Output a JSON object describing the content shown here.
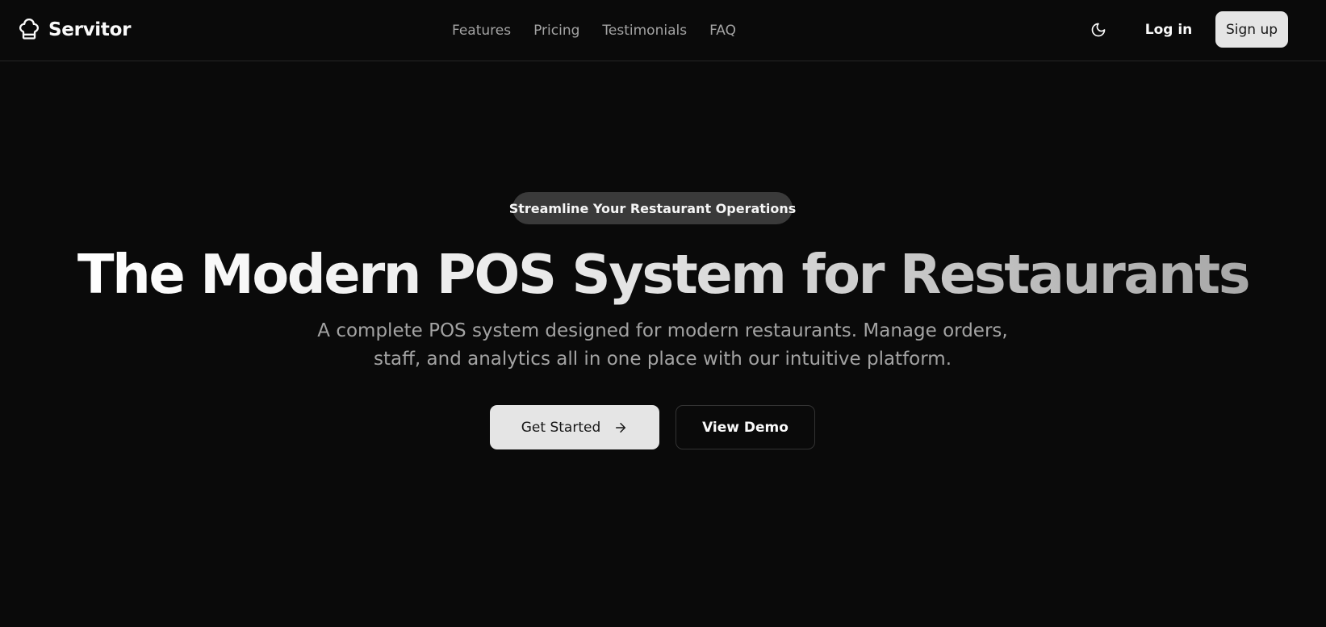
{
  "brand": {
    "name": "Servitor",
    "icon": "chef-hat-icon"
  },
  "nav": {
    "items": [
      {
        "label": "Features"
      },
      {
        "label": "Pricing"
      },
      {
        "label": "Testimonials"
      },
      {
        "label": "FAQ"
      }
    ]
  },
  "header": {
    "theme_icon": "moon-icon",
    "login_label": "Log in",
    "signup_label": "Sign up"
  },
  "hero": {
    "badge": "Streamline Your Restaurant Operations",
    "title": "The Modern POS System for Restaurants",
    "subtitle_line1": "A complete POS system designed for modern restaurants. Manage orders,",
    "subtitle_line2": "staff, and analytics all in one place with our intuitive platform.",
    "primary_cta": "Get Started",
    "primary_cta_icon": "arrow-right-icon",
    "secondary_cta": "View Demo"
  },
  "colors": {
    "background": "#0a0a0a",
    "foreground": "#fafafa",
    "muted": "#a3a3a3",
    "button_light": "#e5e5e5",
    "badge_bg": "#3a3a3a",
    "border": "#262626"
  }
}
